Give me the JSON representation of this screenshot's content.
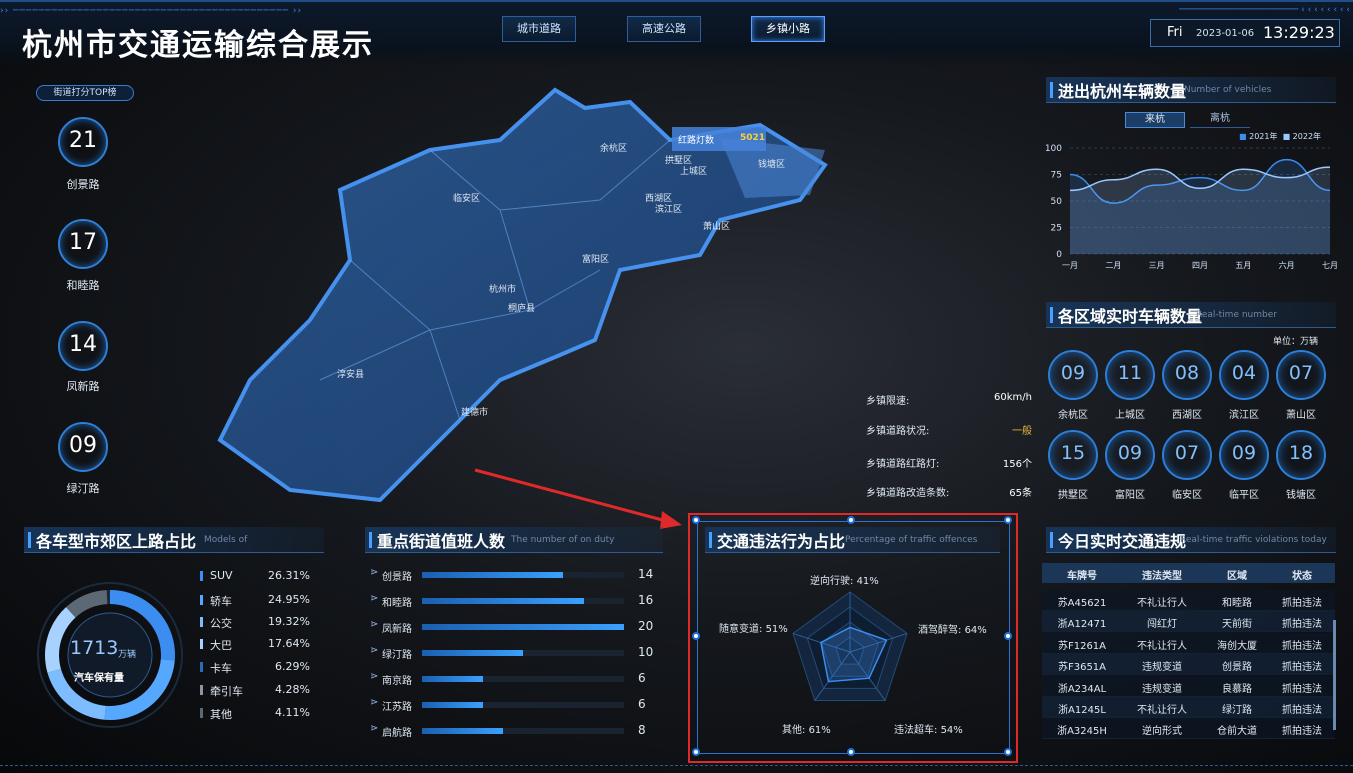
{
  "header": {
    "title": "杭州市交通运输综合展示",
    "nav": [
      "城市道路",
      "高速公路",
      "乡镇小路"
    ],
    "active_nav": 2,
    "day": "Fri",
    "date": "2023-01-06",
    "time": "13:29:23"
  },
  "left": {
    "tag": "街道打分TOP榜",
    "ranks": [
      {
        "value": "21",
        "label": "创景路"
      },
      {
        "value": "17",
        "label": "和睦路"
      },
      {
        "value": "14",
        "label": "凤新路"
      },
      {
        "value": "09",
        "label": "绿汀路"
      }
    ]
  },
  "map": {
    "districts": [
      "余杭区",
      "拱墅区",
      "上城区",
      "钱塘区",
      "临安区",
      "西湖区",
      "滨江区",
      "萧山区",
      "富阳区",
      "杭州市",
      "桐庐县",
      "淳安县",
      "建德市"
    ],
    "tooltip_label": "红路灯数",
    "tooltip_value": "5021"
  },
  "road_info": [
    {
      "name": "乡镇限速:",
      "value": "60km/h"
    },
    {
      "name": "乡镇道路状况:",
      "value": "一般",
      "highlight": "#e9b43a"
    },
    {
      "name": "乡镇道路红路灯:",
      "value": "156个"
    },
    {
      "name": "乡镇道路改造条数:",
      "value": "65条"
    }
  ],
  "vehicle_types": {
    "title": "各车型市郊区上路占比",
    "subtitle": "Models of",
    "total": "1713",
    "unit": "万辆",
    "center_label": "汽车保有量",
    "items": [
      {
        "name": "SUV",
        "value": "26.31%",
        "color": "#3b8df0"
      },
      {
        "name": "轿车",
        "value": "24.95%",
        "color": "#56a8ff"
      },
      {
        "name": "公交",
        "value": "19.32%",
        "color": "#7dbcff"
      },
      {
        "name": "大巴",
        "value": "17.64%",
        "color": "#a7d2ff"
      },
      {
        "name": "卡车",
        "value": "6.29%",
        "color": "#2c6bb8"
      },
      {
        "name": "牵引车",
        "value": "4.28%",
        "color": "#8c97a5"
      },
      {
        "name": "其他",
        "value": "4.11%",
        "color": "#5d6875"
      }
    ]
  },
  "duty": {
    "title": "重点街道值班人数",
    "subtitle": "The number of on duty",
    "max": 20,
    "rows": [
      {
        "name": "创景路",
        "value": 14
      },
      {
        "name": "和睦路",
        "value": 16
      },
      {
        "name": "凤新路",
        "value": 20
      },
      {
        "name": "绿汀路",
        "value": 10
      },
      {
        "name": "南京路",
        "value": 6
      },
      {
        "name": "江苏路",
        "value": 6
      },
      {
        "name": "启航路",
        "value": 8
      }
    ]
  },
  "radar": {
    "title": "交通违法行为占比",
    "subtitle": "Percentage of traffic offences",
    "items": [
      {
        "name": "逆向行驶:",
        "value": "41%",
        "v": 0.41
      },
      {
        "name": "酒驾醉驾:",
        "value": "64%",
        "v": 0.64
      },
      {
        "name": "违法超车:",
        "value": "54%",
        "v": 0.54
      },
      {
        "name": "其他:",
        "value": "61%",
        "v": 0.61
      },
      {
        "name": "随意变道:",
        "value": "51%",
        "v": 0.51
      }
    ]
  },
  "vehicles_io": {
    "title": "进出杭州车辆数量",
    "subtitle": "Number of vehicles",
    "tabs": [
      "来杭",
      "离杭"
    ],
    "active_tab": 0
  },
  "chart_data": {
    "type": "area",
    "x": [
      "一月",
      "二月",
      "三月",
      "四月",
      "五月",
      "六月",
      "七月"
    ],
    "ylim": [
      0,
      100
    ],
    "yticks": [
      0,
      25,
      50,
      75,
      100
    ],
    "series": [
      {
        "name": "2021年",
        "values": [
          75,
          48,
          65,
          72,
          60,
          89,
          60
        ],
        "color": "#3b8df0"
      },
      {
        "name": "2022年",
        "values": [
          60,
          70,
          80,
          62,
          80,
          72,
          82
        ],
        "color": "#9cc8ff"
      }
    ],
    "grid": true,
    "legend": "top-right"
  },
  "regions": {
    "title": "各区域实时车辆数量",
    "subtitle": "Real-time number",
    "unit": "单位：万辆",
    "items": [
      {
        "v": "09",
        "n": "余杭区"
      },
      {
        "v": "11",
        "n": "上城区"
      },
      {
        "v": "08",
        "n": "西湖区"
      },
      {
        "v": "04",
        "n": "滨江区"
      },
      {
        "v": "07",
        "n": "萧山区"
      },
      {
        "v": "15",
        "n": "拱墅区"
      },
      {
        "v": "09",
        "n": "富阳区"
      },
      {
        "v": "07",
        "n": "临安区"
      },
      {
        "v": "09",
        "n": "临平区"
      },
      {
        "v": "18",
        "n": "钱塘区"
      }
    ]
  },
  "violations": {
    "title": "今日实时交通违规",
    "subtitle": "Real-time traffic violations today",
    "headers": [
      "车牌号",
      "违法类型",
      "区域",
      "状态"
    ],
    "rows": [
      [
        "苏A45621",
        "不礼让行人",
        "和睦路",
        "抓拍违法"
      ],
      [
        "浙A12471",
        "闯红灯",
        "天前街",
        "抓拍违法"
      ],
      [
        "苏F1261A",
        "不礼让行人",
        "海创大厦",
        "抓拍违法"
      ],
      [
        "苏F3651A",
        "违规变道",
        "创景路",
        "抓拍违法"
      ],
      [
        "浙A234AL",
        "违规变道",
        "良慕路",
        "抓拍违法"
      ],
      [
        "浙A1245L",
        "不礼让行人",
        "绿汀路",
        "抓拍违法"
      ],
      [
        "浙A3245H",
        "逆向形式",
        "仓前大道",
        "抓拍违法"
      ]
    ]
  }
}
